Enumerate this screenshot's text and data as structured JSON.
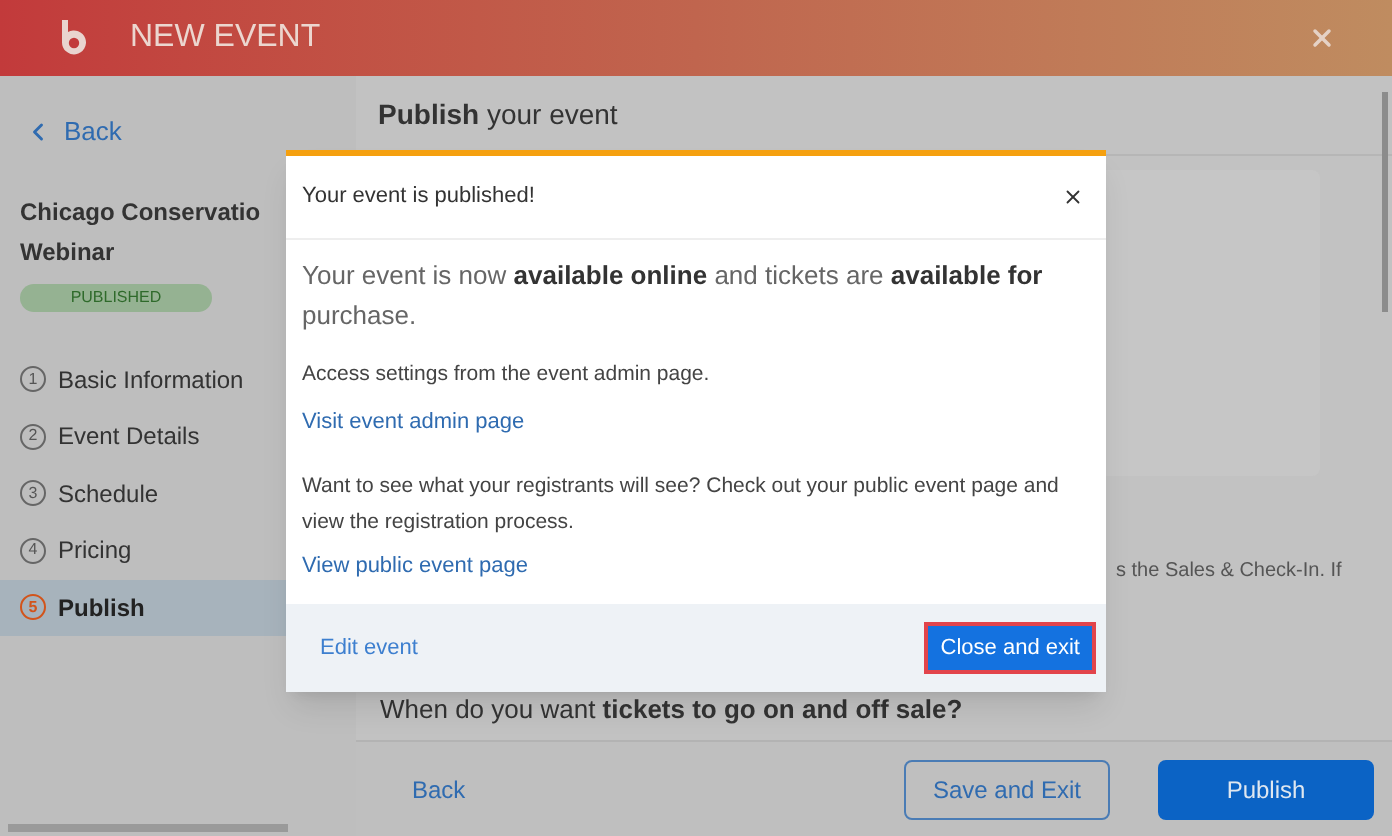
{
  "header": {
    "title": "NEW EVENT"
  },
  "sidebar": {
    "back": "Back",
    "title_lines": [
      "Chicago Conservatio",
      "Webinar"
    ],
    "status": "PUBLISHED",
    "steps": [
      {
        "number": "1",
        "label": "Basic Information",
        "selected": false
      },
      {
        "number": "2",
        "label": "Event Details",
        "selected": false
      },
      {
        "number": "3",
        "label": "Schedule",
        "selected": false
      },
      {
        "number": "4",
        "label": "Pricing",
        "selected": false
      },
      {
        "number": "5",
        "label": "Publish",
        "selected": true
      }
    ]
  },
  "main": {
    "heading": "**Publish** your event",
    "partial_text": "s the Sales & Check-In. If",
    "question": "When do you want **tickets to go on and off sale?**"
  },
  "footer": {
    "back": "Back",
    "save": "Save and Exit",
    "publish": "Publish"
  },
  "modal": {
    "title": "Your event is published!",
    "lead": "Your event is now **available online** and tickets are **available for** purchase.",
    "admin_text": "Access settings from the event admin page.",
    "admin_link": "Visit event admin page",
    "public_text": "Want to see what your registrants will see? Check out your public event page and view the registration process.",
    "public_link": "View public event page",
    "edit": "Edit event",
    "primary": "Close and exit"
  }
}
